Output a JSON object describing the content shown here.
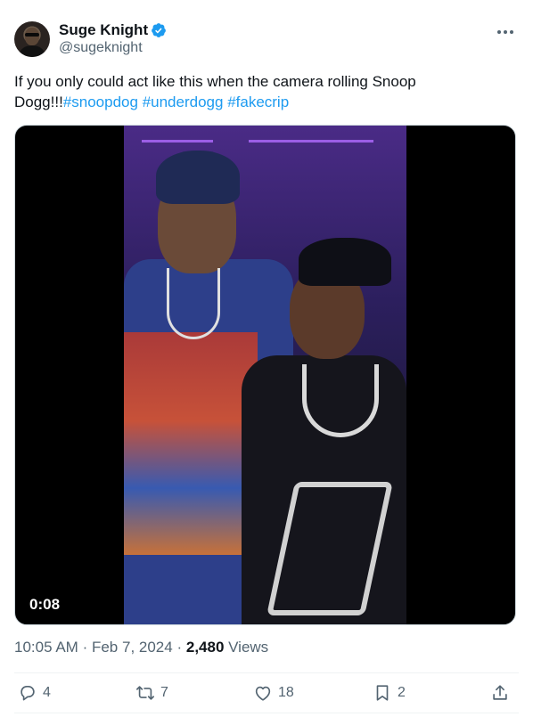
{
  "author": {
    "display_name": "Suge Knight",
    "handle": "@sugeknight"
  },
  "tweet": {
    "text_plain": "If you only could act like this when the camera rolling Snoop Dogg!!!",
    "hashtags": [
      "#snoopdog",
      "#underdogg",
      "#fakecrip"
    ]
  },
  "media": {
    "duration": "0:08"
  },
  "meta": {
    "time": "10:05 AM",
    "separator": "·",
    "date": "Feb 7, 2024",
    "views_count": "2,480",
    "views_label": "Views"
  },
  "actions": {
    "replies": "4",
    "reposts": "7",
    "likes": "18",
    "bookmarks": "2"
  },
  "colors": {
    "link": "#1d9bf0",
    "secondary_text": "#536471",
    "verified": "#1d9bf0"
  },
  "icons": [
    "verified-badge-icon",
    "more-options-icon",
    "reply-icon",
    "repost-icon",
    "like-icon",
    "bookmark-icon",
    "share-icon"
  ]
}
